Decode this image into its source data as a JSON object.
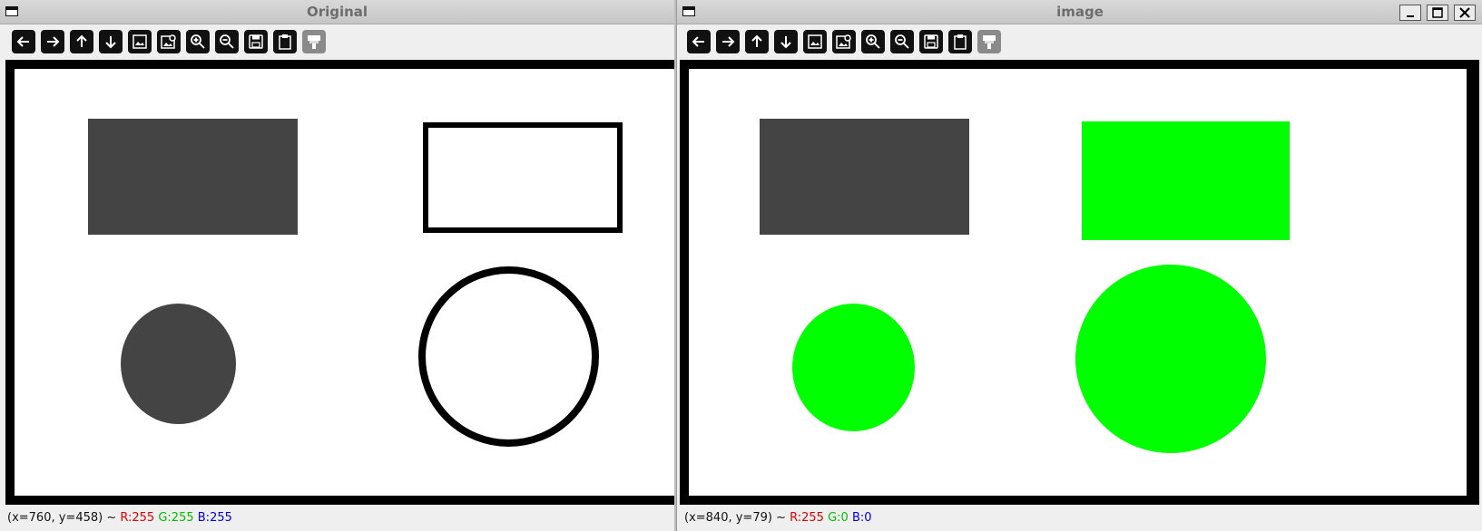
{
  "windows": {
    "left": {
      "title": "Original",
      "status": {
        "coords": "(x=760, y=458) ~",
        "r": "R:255",
        "g": "G:255",
        "b": "B:255"
      }
    },
    "right": {
      "title": "image",
      "status": {
        "coords": "(x=840, y=79) ~",
        "r": "R:255",
        "g": "G:0",
        "b": "B:0"
      }
    }
  },
  "toolbar": [
    {
      "icon": "arrow-left-icon"
    },
    {
      "icon": "arrow-right-icon"
    },
    {
      "icon": "arrow-up-icon"
    },
    {
      "icon": "arrow-down-icon"
    },
    {
      "icon": "image-icon"
    },
    {
      "icon": "image-zoom-icon"
    },
    {
      "icon": "zoom-in-icon"
    },
    {
      "icon": "zoom-out-icon"
    },
    {
      "icon": "save-icon"
    },
    {
      "icon": "clipboard-icon"
    },
    {
      "icon": "properties-icon"
    }
  ],
  "colors": {
    "dark_fill": "#444444",
    "green_fill": "#00ff00",
    "dot_red": "#ff0000",
    "status_r": "#e00000",
    "status_g": "#00c000",
    "status_b": "#0000e0"
  }
}
